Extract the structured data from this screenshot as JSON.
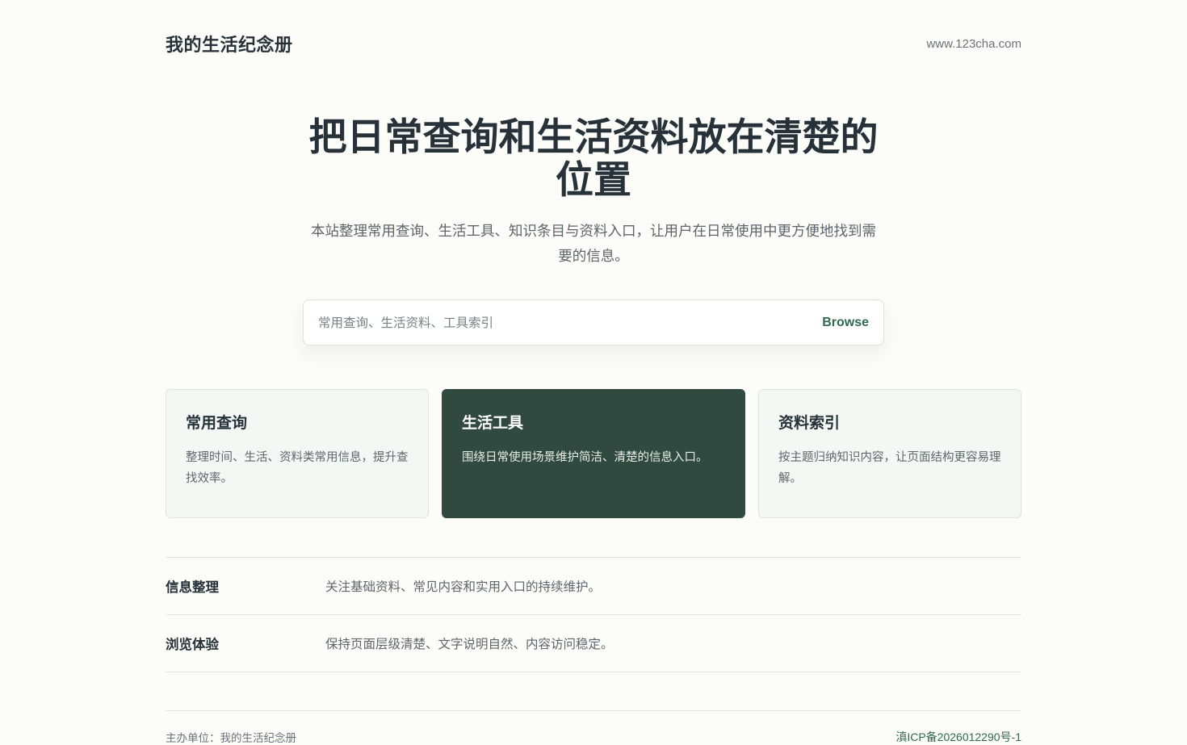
{
  "header": {
    "brand": "我的生活纪念册",
    "site_url": "www.123cha.com"
  },
  "hero": {
    "title": "把日常查询和生活资料放在清楚的位置",
    "description": "本站整理常用查询、生活工具、知识条目与资料入口，让用户在日常使用中更方便地找到需要的信息。"
  },
  "search": {
    "placeholder": "常用查询、生活资料、工具索引",
    "value": "",
    "button_label": "Browse"
  },
  "cards": [
    {
      "title": "常用查询",
      "description": "整理时间、生活、资料类常用信息，提升查找效率。"
    },
    {
      "title": "生活工具",
      "description": "围绕日常使用场景维护简洁、清楚的信息入口。"
    },
    {
      "title": "资料索引",
      "description": "按主题归纳知识内容，让页面结构更容易理解。"
    }
  ],
  "info": [
    {
      "label": "信息整理",
      "text": "关注基础资料、常见内容和实用入口的持续维护。"
    },
    {
      "label": "浏览体验",
      "text": "保持页面层级清楚、文字说明自然、内容访问稳定。"
    }
  ],
  "footer": {
    "owner": "主办单位：我的生活纪念册",
    "icp": "滇ICP备2026012290号-1"
  },
  "colors": {
    "background": "#fcfcf8",
    "accent": "#2f6a4f",
    "dark_card": "#314a41"
  }
}
